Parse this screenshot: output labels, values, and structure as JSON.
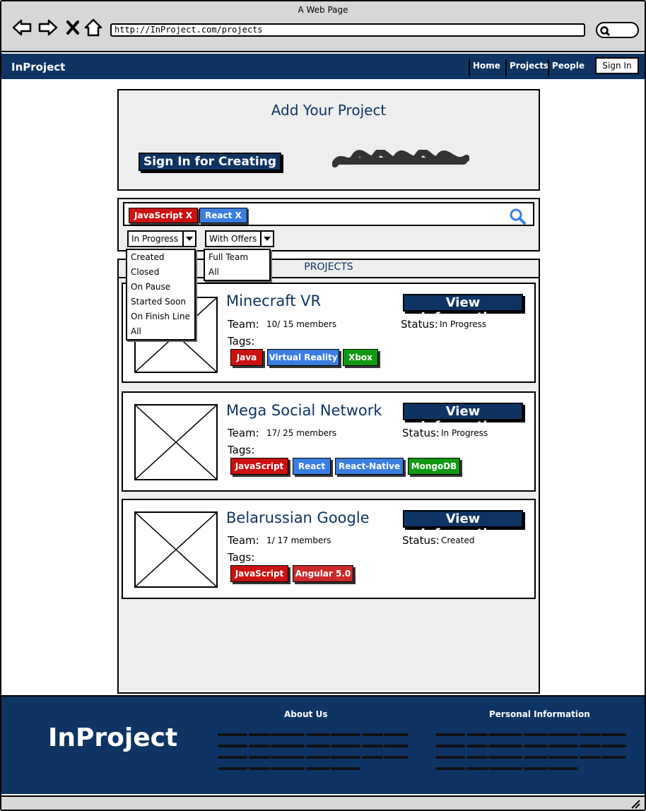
{
  "browser": {
    "window_title": "A Web Page",
    "url": "http://InProject.com/projects",
    "icons": [
      "back-icon",
      "forward-icon",
      "close-icon",
      "home-icon",
      "search-icon"
    ]
  },
  "navbar": {
    "brand": "InProject",
    "links": [
      "Home",
      "Projects",
      "People"
    ],
    "signin_label": "Sign In"
  },
  "add_project": {
    "title": "Add Your Project",
    "signin_button": "Sign In for Creating"
  },
  "search": {
    "chips": [
      {
        "label": "JavaScript X",
        "color": "#cc1111"
      },
      {
        "label": "React X",
        "color": "#3a7ee0"
      }
    ],
    "status_filter": {
      "selected": "In Progress",
      "options": [
        "Created",
        "Closed",
        "On Pause",
        "Started Soon",
        "On Finish Line",
        "All"
      ]
    },
    "offers_filter": {
      "selected": "With Offers",
      "options": [
        "Full Team",
        "All"
      ]
    }
  },
  "projects": {
    "header": "PROJECTS",
    "team_label": "Team:",
    "status_label": "Status:",
    "tags_label": "Tags:",
    "view_button": "View Information",
    "items": [
      {
        "name": "Minecraft VR",
        "team": "10/ 15 members",
        "status": "In Progress",
        "tags": [
          {
            "label": "Java",
            "color": "#cc1111"
          },
          {
            "label": "Virtual Reality",
            "color": "#3a7ee0"
          },
          {
            "label": "Xbox",
            "color": "#119911"
          }
        ]
      },
      {
        "name": "Mega Social Network",
        "team": "17/ 25 members",
        "status": "In Progress",
        "tags": [
          {
            "label": "JavaScript",
            "color": "#cc1111"
          },
          {
            "label": "React",
            "color": "#3a7ee0"
          },
          {
            "label": "React-Native",
            "color": "#3a7ee0"
          },
          {
            "label": "MongoDB",
            "color": "#119911"
          }
        ]
      },
      {
        "name": "Belarussian Google",
        "team": "1/ 17 members",
        "status": "Created",
        "tags": [
          {
            "label": "JavaScript",
            "color": "#cc1111"
          },
          {
            "label": "Angular 5.0",
            "color": "#cc2a2a"
          }
        ]
      }
    ]
  },
  "footer": {
    "brand": "InProject",
    "about_heading": "About Us",
    "personal_heading": "Personal Information"
  },
  "colors": {
    "primary": "#0e3463",
    "panel": "#eeeeee",
    "chrome": "#d7d7d7"
  }
}
